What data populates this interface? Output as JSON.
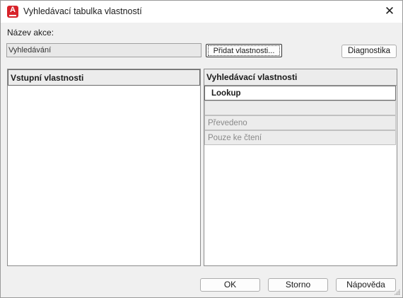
{
  "window": {
    "title": "Vyhledávací tabulka vlastností",
    "icon_letter": "A",
    "close_glyph": "✕"
  },
  "action": {
    "label": "Název akce:",
    "value": "Vyhledávání"
  },
  "buttons": {
    "add_properties": "Přidat vlastnosti...",
    "diagnostics": "Diagnostika",
    "ok": "OK",
    "cancel": "Storno",
    "help": "Nápověda"
  },
  "input_panel": {
    "header": "Vstupní vlastnosti"
  },
  "lookup_panel": {
    "header": "Vyhledávací vlastnosti",
    "rows": [
      "Lookup",
      "",
      "Převedeno",
      "Pouze ke čtení"
    ]
  },
  "colors": {
    "app_icon": "#d8232a",
    "dialog_bg": "#f0f0f0",
    "header_bg": "#ececec"
  }
}
